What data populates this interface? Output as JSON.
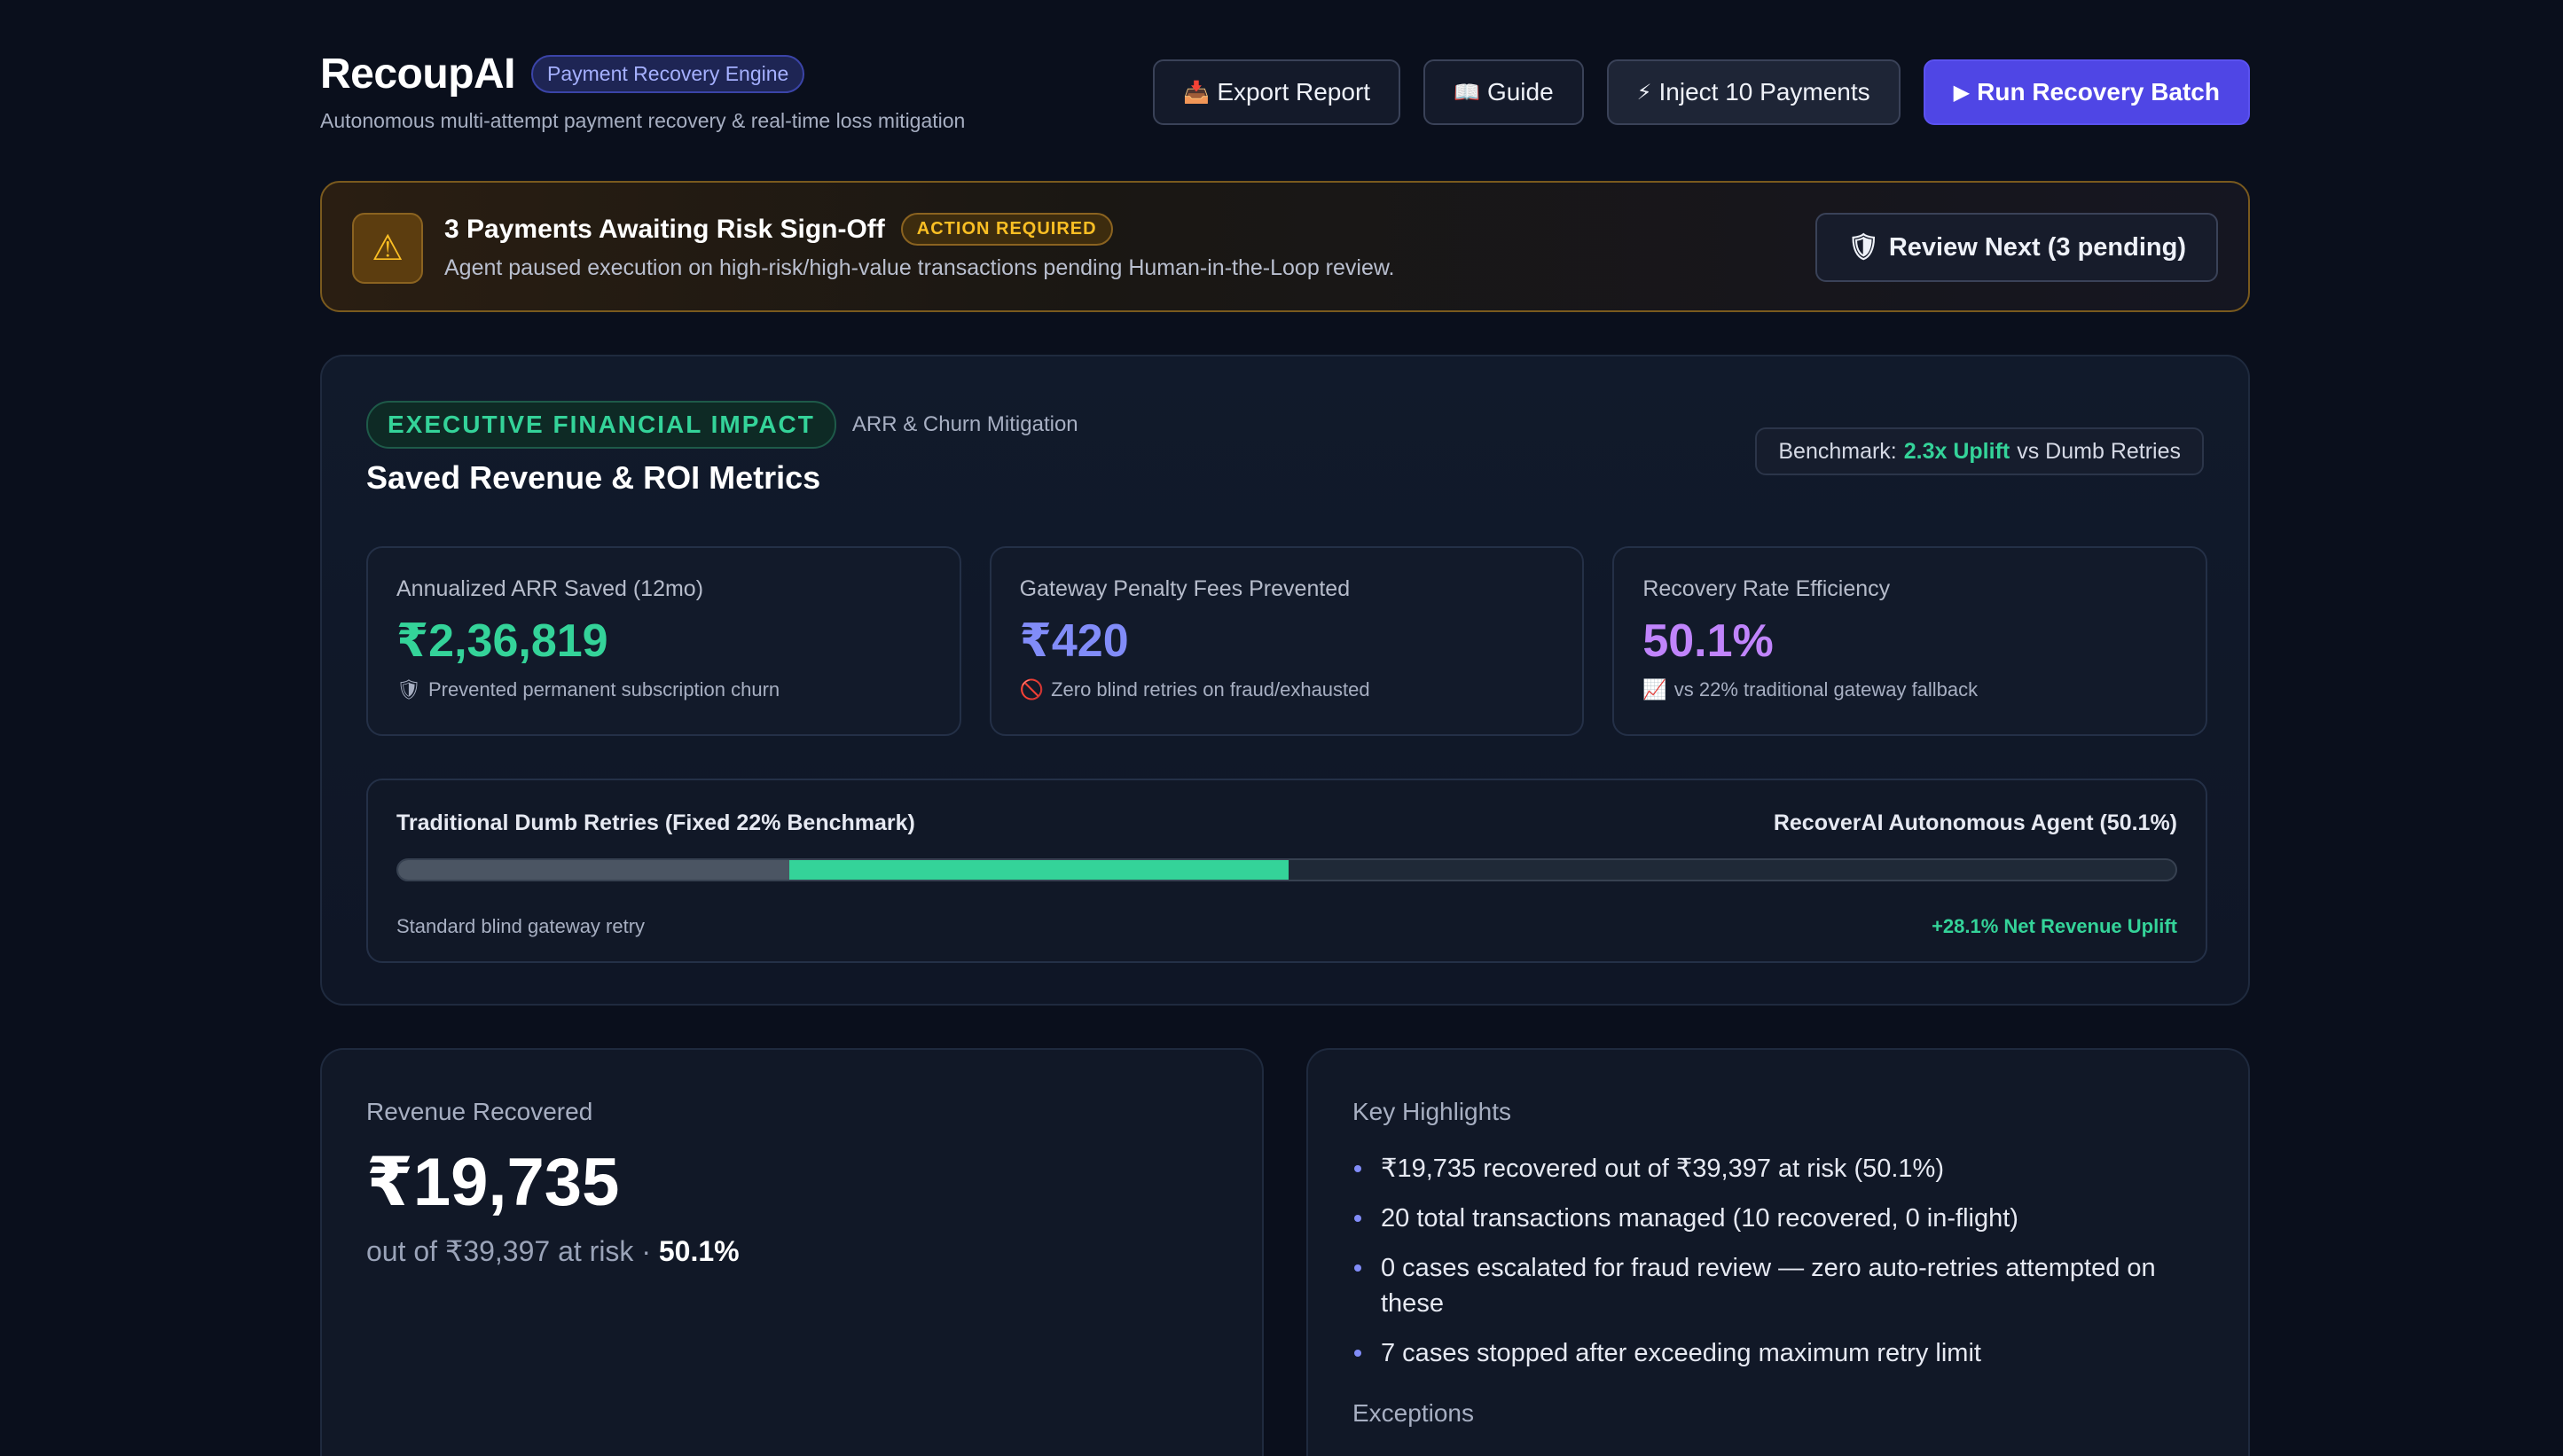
{
  "header": {
    "brand": "RecoupAI",
    "badge": "Payment Recovery Engine",
    "subtitle": "Autonomous multi-attempt payment recovery & real-time loss mitigation",
    "actions": [
      {
        "icon": "📥",
        "icon_name": "inbox-tray-icon",
        "label": "Export Report"
      },
      {
        "icon": "📖",
        "icon_name": "book-icon",
        "label": "Guide"
      },
      {
        "icon": "⚡",
        "icon_name": "lightning-icon",
        "label": "Inject 10 Payments"
      },
      {
        "icon": "▶",
        "icon_name": "play-icon",
        "label": "Run Recovery Batch"
      }
    ]
  },
  "alert": {
    "icon": "⚠",
    "title": "3 Payments Awaiting Risk Sign-Off",
    "badge": "ACTION REQUIRED",
    "description": "Agent paused execution on high-risk/high-value transactions pending Human-in-the-Loop review.",
    "button_icon": "🛡",
    "button_label": "Review Next (3 pending)"
  },
  "executive": {
    "tag": "EXECUTIVE FINANCIAL IMPACT",
    "tag_sub": "ARR & Churn Mitigation",
    "title": "Saved Revenue & ROI Metrics",
    "benchmark_prefix": "Benchmark:",
    "benchmark_value": "2.3x Uplift",
    "benchmark_suffix": "vs Dumb Retries",
    "cards": [
      {
        "label": "Annualized ARR Saved (12mo)",
        "value": "₹2,36,819",
        "note_icon": "🛡",
        "note": "Prevented permanent subscription churn"
      },
      {
        "label": "Gateway Penalty Fees Prevented",
        "value": "₹420",
        "note_icon": "🚫",
        "note": "Zero blind retries on fraud/exhausted"
      },
      {
        "label": "Recovery Rate Efficiency",
        "value": "50.1%",
        "note_icon": "📈",
        "note": "vs 22% traditional gateway fallback"
      }
    ],
    "comparison": {
      "left_label": "Traditional Dumb Retries (Fixed 22% Benchmark)",
      "right_label": "RecoverAI Autonomous Agent (50.1%)",
      "baseline_pct": 22,
      "agent_pct": 50.1,
      "foot_left": "Standard blind gateway retry",
      "foot_right": "+28.1% Net Revenue Uplift"
    }
  },
  "revenue": {
    "label": "Revenue Recovered",
    "value": "₹19,735",
    "sub": "out of ₹39,397 at risk ·",
    "pct": "50.1%"
  },
  "highlights": {
    "label": "Key Highlights",
    "items": [
      "₹19,735 recovered out of ₹39,397 at risk (50.1%)",
      "20 total transactions managed (10 recovered, 0 in-flight)",
      "0 cases escalated for fraud review — zero auto-retries attempted on these",
      "7 cases stopped after exceeding maximum retry limit"
    ],
    "exceptions_label": "Exceptions"
  },
  "colors": {
    "accent": "#4f46e5",
    "green": "#34d399",
    "warning": "#fbbf24",
    "purple": "#c084fc"
  }
}
